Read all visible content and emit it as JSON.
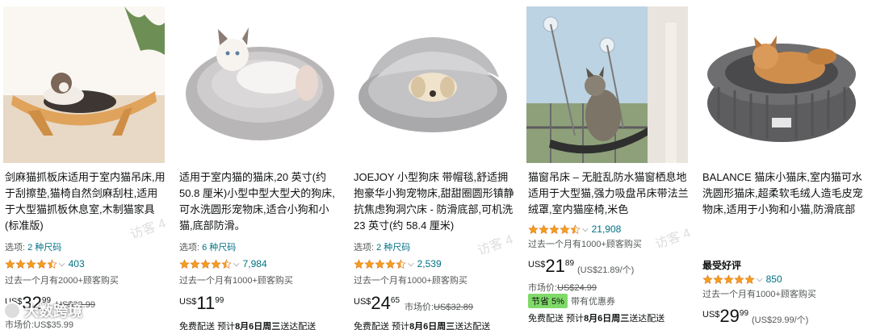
{
  "products": [
    {
      "title": "剑麻猫抓板床适用于室内猫吊床,用于刮擦垫,猫椅自然剑麻刮柱,适用于大型猫抓板休息室,木制猫家具(标准版)",
      "options_label": "选项:",
      "options_link": "2 种尺码",
      "rating": 4.5,
      "review_count": "403",
      "bought": "过去一个月有2000+顾客购买",
      "currency": "US$",
      "price_whole": "32",
      "price_fraction": "99",
      "list_price_label": "",
      "list_price": "US$32.99",
      "extra": "市场价:US$35.99"
    },
    {
      "title": "适用于室内猫的猫床,20 英寸(约 50.8 厘米)小型中型大型犬的狗床,可水洗圆形宠物床,适合小狗和小猫,底部防滑。",
      "options_label": "选项:",
      "options_link": "6 种尺码",
      "rating": 4.5,
      "review_count": "7,984",
      "bought": "过去一个月有1000+顾客购买",
      "currency": "US$",
      "price_whole": "11",
      "price_fraction": "99",
      "ship_a": "免费配送",
      "ship_b": "预计",
      "ship_date": "8月6日周三",
      "ship_c": "送达配送"
    },
    {
      "title": "JOEJOY 小型狗床 带帽毯,舒适拥抱豪华小狗宠物床,甜甜圈圆形镇静抗焦虑狗洞穴床 - 防滑底部,可机洗 23 英寸(约 58.4 厘米)",
      "options_label": "选项:",
      "options_link": "2 种尺码",
      "rating": 4.5,
      "review_count": "2,539",
      "bought": "过去一个月有1000+顾客购买",
      "currency": "US$",
      "price_whole": "24",
      "price_fraction": "65",
      "list_price_label": "市场价:",
      "list_price": "US$32.89",
      "ship_a": "免费配送",
      "ship_b": "预计",
      "ship_date": "8月6日周三",
      "ship_c": "送达配送"
    },
    {
      "title": "猫窗吊床 – 无脏乱防水猫窗栖息地适用于大型猫,强力吸盘吊床带法兰绒罩,室内猫座椅,米色",
      "options_label": "",
      "options_link": "",
      "rating": 4.5,
      "review_count": "21,908",
      "bought": "过去一个月有1000+顾客购买",
      "currency": "US$",
      "price_whole": "21",
      "price_fraction": "89",
      "unit_price": "(US$21.89/个)",
      "market_label": "市场价:",
      "market_price": "US$24.99",
      "deal_badge": "节省 5%",
      "deal_coupon": "带有优惠券",
      "ship_a": "免费配送",
      "ship_b": "预计",
      "ship_date": "8月6日周三",
      "ship_c": "送达配送"
    },
    {
      "title": "BALANCE 猫床小猫床,室内猫可水洗圆形猫床,超柔软毛绒人造毛皮宠物床,适用于小狗和小猫,防滑底部",
      "options_label": "",
      "options_link": "",
      "best_label": "最受好评",
      "rating": 5,
      "review_count": "850",
      "bought": "过去一个月有1000+顾客购买",
      "currency": "US$",
      "price_whole": "29",
      "price_fraction": "99",
      "unit_price": "(US$29.99/个)"
    }
  ],
  "watermark": "访客 4",
  "logo_text": "大数跨境",
  "colors": {
    "star": "#f49f19",
    "link": "#007185",
    "deal": "#7fda69"
  }
}
